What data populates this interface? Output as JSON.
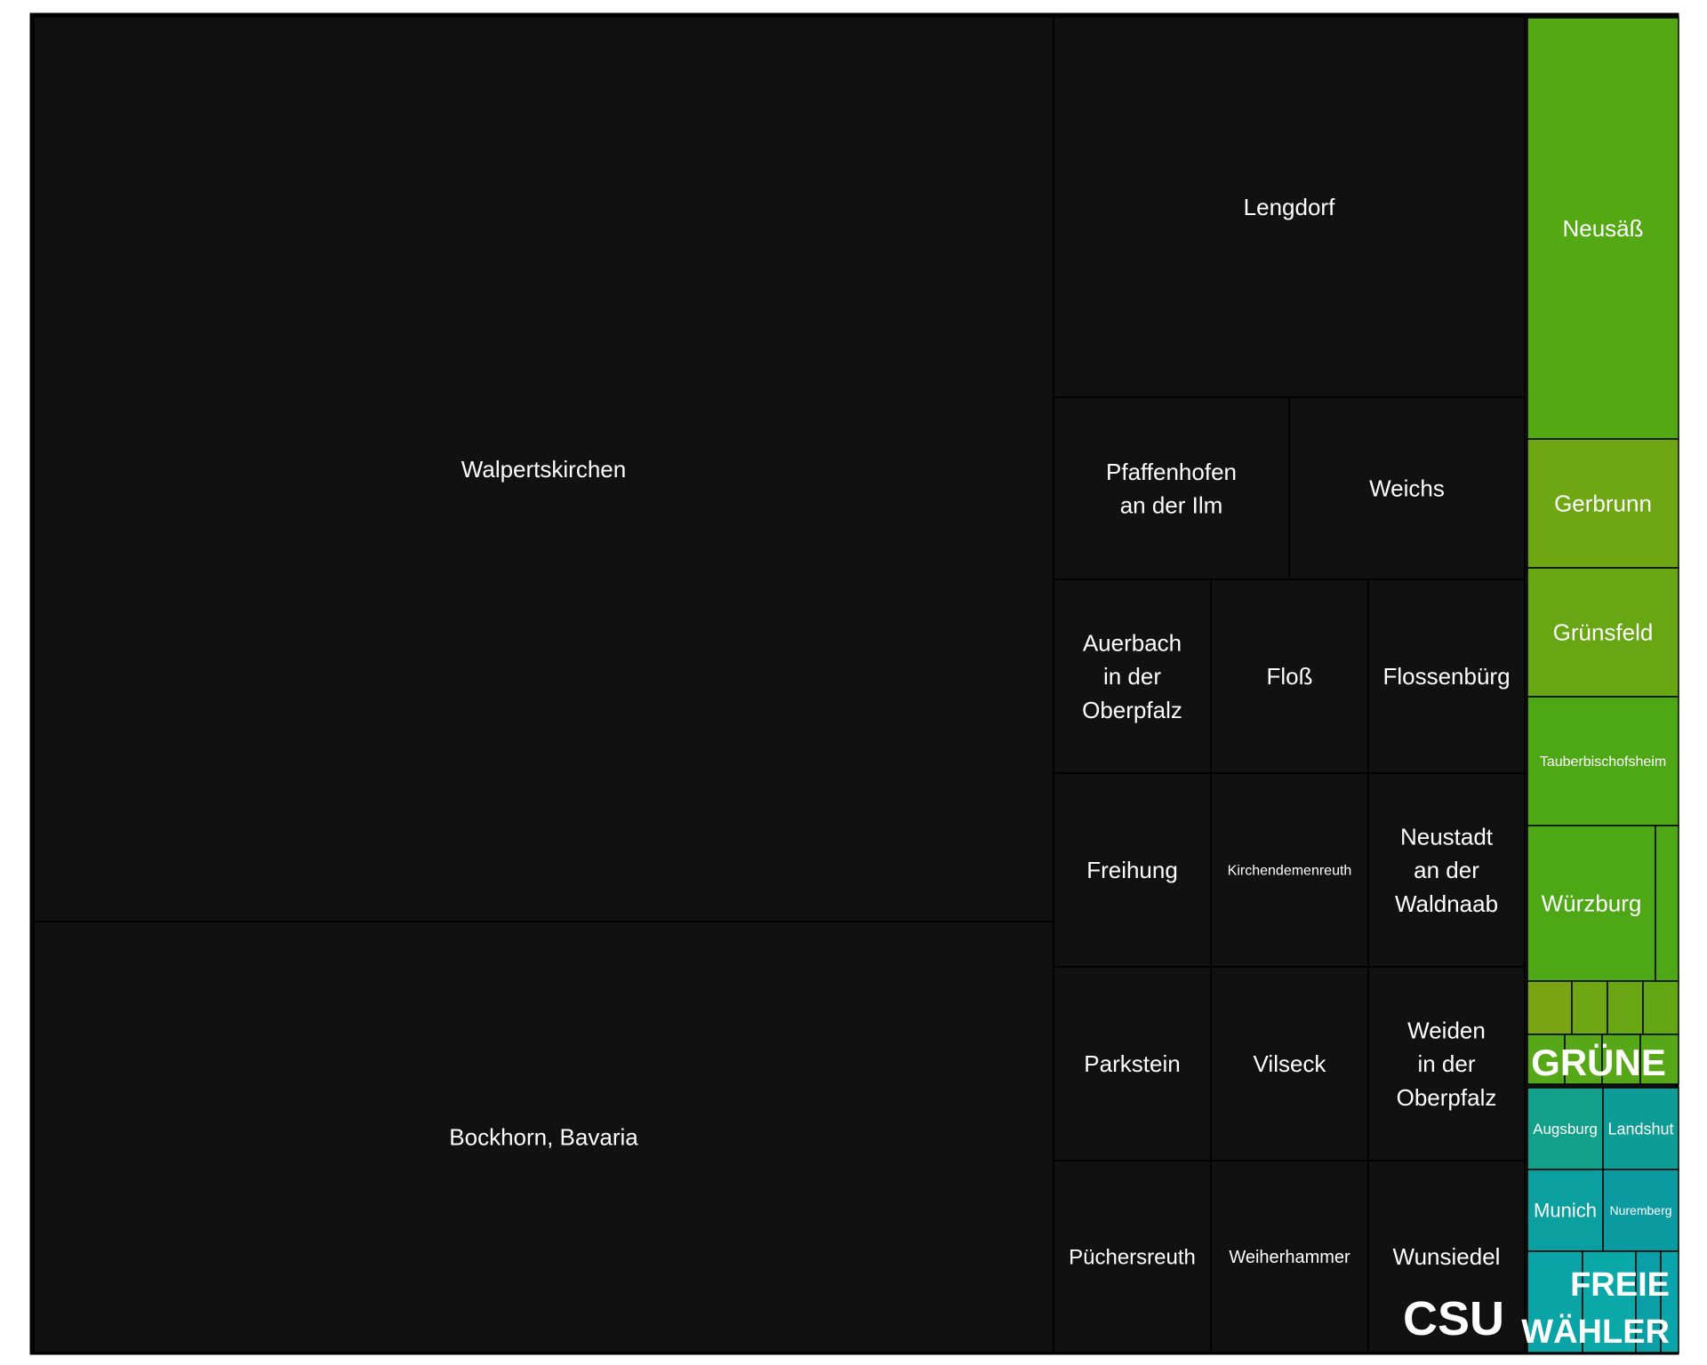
{
  "chart_data": {
    "type": "treemap",
    "title": "",
    "groups": [
      {
        "name": "CSU",
        "color": "#111111",
        "items": [
          {
            "label": "Walpertskirchen",
            "value": 769
          },
          {
            "label": "Bockhorn, Bavaria",
            "value": 369
          },
          {
            "label": "Lengdorf",
            "value": 150
          },
          {
            "label": "Pfaffenhofen an der Ilm",
            "value": 36
          },
          {
            "label": "Weichs",
            "value": 36
          },
          {
            "label": "Auerbach in der Oberpfalz",
            "value": 25
          },
          {
            "label": "Floß",
            "value": 25
          },
          {
            "label": "Flossenbürg",
            "value": 25
          },
          {
            "label": "Freihung",
            "value": 25
          },
          {
            "label": "Kirchendemenreuth",
            "value": 25
          },
          {
            "label": "Neustadt an der Waldnaab",
            "value": 25
          },
          {
            "label": "Parkstein",
            "value": 25
          },
          {
            "label": "Vilseck",
            "value": 25
          },
          {
            "label": "Weiden in der Oberpfalz",
            "value": 25
          },
          {
            "label": "Püchersreuth",
            "value": 25
          },
          {
            "label": "Weiherhammer",
            "value": 25
          },
          {
            "label": "Wunsiedel",
            "value": 25
          }
        ]
      },
      {
        "name": "GRÜNE",
        "color": "#56a818",
        "items": [
          {
            "label": "Neusäß",
            "value": 27,
            "color": "#53a814"
          },
          {
            "label": "Gerbrunn",
            "value": 8,
            "color": "#6fa614"
          },
          {
            "label": "Grünsfeld",
            "value": 8,
            "color": "#68a614"
          },
          {
            "label": "Tauberbischofsheim",
            "value": 8,
            "color": "#4ea816"
          },
          {
            "label": "Würzburg",
            "value": 9,
            "color": "#4ea816"
          },
          {
            "label": "",
            "value": 1.5,
            "color": "#4ea816"
          },
          {
            "label": "",
            "value": 1,
            "color": "#7aa414"
          },
          {
            "label": "",
            "value": 1,
            "color": "#6fa614"
          },
          {
            "label": "",
            "value": 1,
            "color": "#6aa614"
          },
          {
            "label": "",
            "value": 1,
            "color": "#62a614"
          },
          {
            "label": "",
            "value": 0.4,
            "color": "#56a818"
          },
          {
            "label": "",
            "value": 0.4,
            "color": "#56a818"
          },
          {
            "label": "",
            "value": 0.4,
            "color": "#56a818"
          },
          {
            "label": "",
            "value": 0.4,
            "color": "#56a818"
          }
        ]
      },
      {
        "name": "FREIE WÄHLER",
        "color": "#0aa7a7",
        "items": [
          {
            "label": "Augsburg",
            "value": 5,
            "color": "#12a08a"
          },
          {
            "label": "Landshut",
            "value": 5,
            "color": "#0e9c96"
          },
          {
            "label": "Munich",
            "value": 5,
            "color": "#0b9fa0"
          },
          {
            "label": "Nuremberg",
            "value": 5,
            "color": "#0a9aa0"
          },
          {
            "label": "",
            "value": 0.5,
            "color": "#0aa3a6"
          },
          {
            "label": "",
            "value": 0.5,
            "color": "#0ba8a8"
          },
          {
            "label": "",
            "value": 0.5,
            "color": "#0a9fa6"
          },
          {
            "label": "",
            "value": 0.5,
            "color": "#0aa5aa"
          }
        ]
      }
    ],
    "grid": false,
    "legend": "none"
  }
}
